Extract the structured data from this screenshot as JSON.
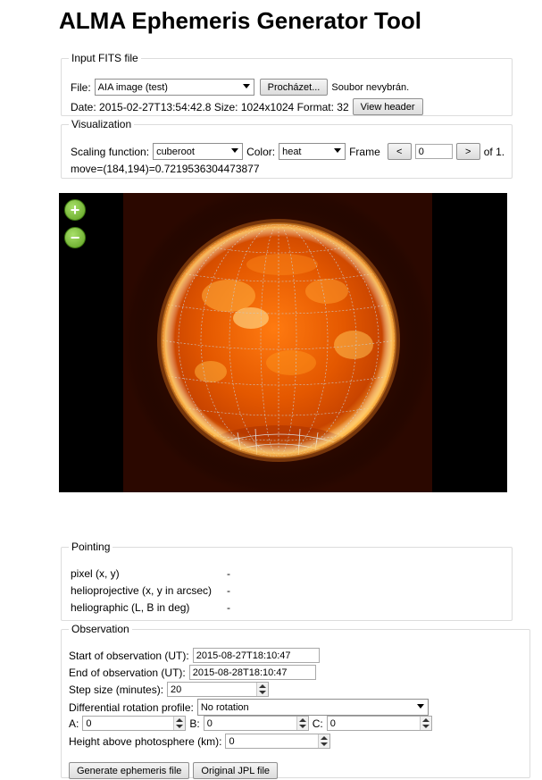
{
  "page": {
    "title": "ALMA Ephemeris Generator Tool"
  },
  "input_fits": {
    "legend": "Input FITS file",
    "file_label": "File:",
    "file_select": "AIA image (test)",
    "browse_button": "Procházet...",
    "no_file_text": "Soubor nevybrán.",
    "date_label": "Date:",
    "date_value": "2015-02-27T13:54:42.8",
    "size_label": "Size:",
    "size_value": "1024x1024",
    "format_label": "Format:",
    "format_value": "32",
    "view_header_button": "View header"
  },
  "visualization": {
    "legend": "Visualization",
    "scaling_label": "Scaling function:",
    "scaling_value": "cuberoot",
    "color_label": "Color:",
    "color_value": "heat",
    "frame_label": "Frame",
    "prev_button": "<",
    "frame_value": "0",
    "next_button": ">",
    "frame_total": "of 1.",
    "move_text": "move=(184,194)=0.7219536304473877"
  },
  "viewer": {
    "zoom_in_icon": "zoom-in-icon",
    "zoom_out_icon": "zoom-out-icon",
    "zoom_in_glyph": "+",
    "zoom_out_glyph": "−",
    "sun_color": "#e05a00",
    "grid_color": "#c8c8c8"
  },
  "pointing": {
    "legend": "Pointing",
    "rows": [
      {
        "label": "pixel (x, y)",
        "value": "-"
      },
      {
        "label": "helioprojective (x, y in arcsec)",
        "value": "-"
      },
      {
        "label": "heliographic (L, B in deg)",
        "value": "-"
      }
    ]
  },
  "observation": {
    "legend": "Observation",
    "start_label": "Start of observation (UT):",
    "start_value": "2015-08-27T18:10:47",
    "end_label": "End of observation (UT):",
    "end_value": "2015-08-28T18:10:47",
    "step_label": "Step size (minutes):",
    "step_value": "20",
    "diffrot_label": "Differential rotation profile:",
    "diffrot_value": "No rotation",
    "a_label": "A:",
    "a_value": "0",
    "b_label": "B:",
    "b_value": "0",
    "c_label": "C:",
    "c_value": "0",
    "height_label": "Height above photosphere (km):",
    "height_value": "0",
    "generate_button": "Generate ephemeris file",
    "jpl_button": "Original JPL file"
  }
}
